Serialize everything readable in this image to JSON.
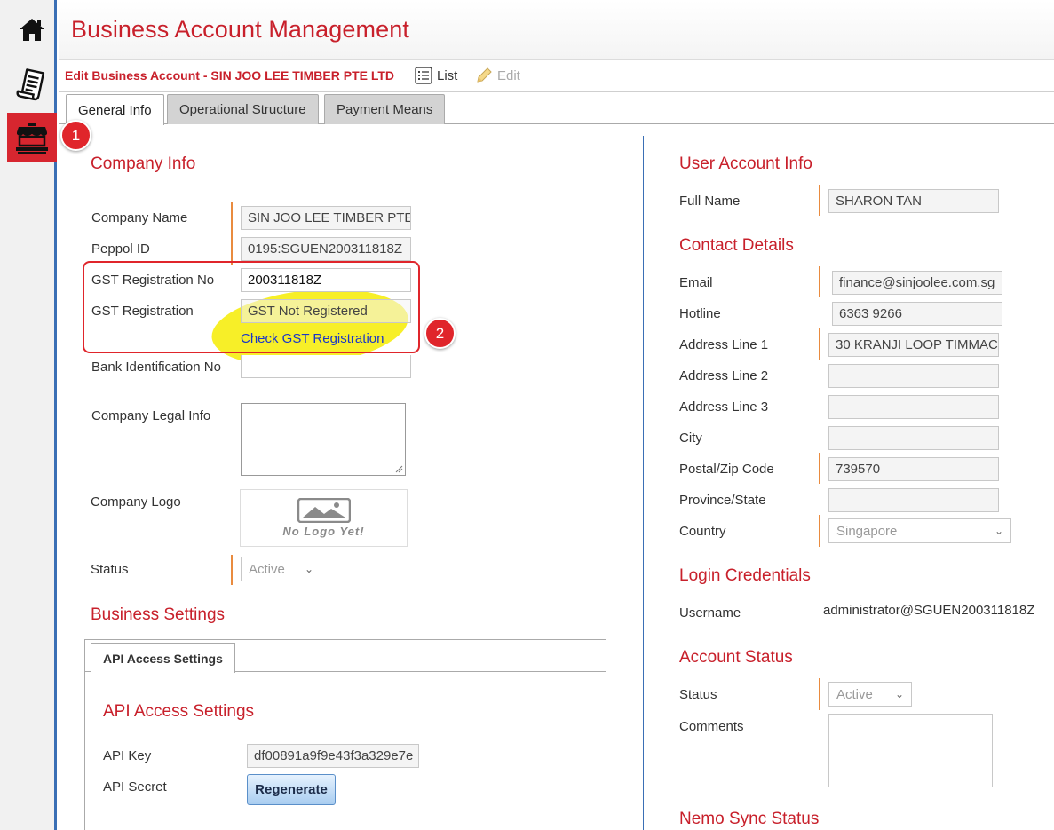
{
  "header": {
    "title": "Business Account Management"
  },
  "subbar": {
    "edit_title": "Edit Business Account - SIN JOO LEE TIMBER PTE LTD",
    "list_label": "List",
    "edit_label": "Edit"
  },
  "tabs": [
    {
      "label": "General Info"
    },
    {
      "label": "Operational Structure"
    },
    {
      "label": "Payment Means"
    }
  ],
  "badges": [
    "1",
    "2"
  ],
  "company": {
    "section": "Company Info",
    "name_label": "Company Name",
    "name_value": "SIN JOO LEE TIMBER PTE LTD",
    "peppol_label": "Peppol ID",
    "peppol_value": "0195:SGUEN200311818Z",
    "gstno_label": "GST Registration No",
    "gstno_value": "200311818Z",
    "gstreg_label": "GST Registration",
    "gstreg_value": "GST Not Registered",
    "check_link": "Check GST Registration",
    "bank_label": "Bank Identification No",
    "legal_label": "Company Legal Info",
    "logo_label": "Company Logo",
    "logo_text": "No Logo Yet!",
    "status_label": "Status",
    "status_value": "Active"
  },
  "business": {
    "section": "Business Settings",
    "tab": "API Access Settings",
    "subsection": "API Access Settings",
    "key_label": "API Key",
    "key_value": "df00891a9f9e43f3a329e7e",
    "secret_label": "API Secret",
    "regen_label": "Regenerate"
  },
  "user": {
    "section": "User Account Info",
    "fullname_label": "Full Name",
    "fullname_value": "SHARON TAN"
  },
  "contact": {
    "section": "Contact Details",
    "email_label": "Email",
    "email_value": "finance@sinjoolee.com.sg",
    "hotline_label": "Hotline",
    "hotline_value": "6363 9266",
    "addr1_label": "Address Line 1",
    "addr1_value": "30 KRANJI LOOP TIMMAC",
    "addr2_label": "Address Line 2",
    "addr2_value": "",
    "addr3_label": "Address Line 3",
    "addr3_value": "",
    "city_label": "City",
    "city_value": "",
    "postal_label": "Postal/Zip Code",
    "postal_value": "739570",
    "province_label": "Province/State",
    "province_value": "",
    "country_label": "Country",
    "country_value": "Singapore"
  },
  "login": {
    "section": "Login Credentials",
    "username_label": "Username",
    "username_value": "administrator@SGUEN200311818Z"
  },
  "account": {
    "section": "Account Status",
    "status_label": "Status",
    "status_value": "Active",
    "comments_label": "Comments"
  },
  "nemo": {
    "section": "Nemo Sync Status"
  },
  "colors": {
    "brand_red": "#c8202b",
    "sidebar_active": "#d7262f",
    "accent_blue": "#3a6fb5",
    "required": "#e98b3f",
    "highlight": "#f7ee1c"
  }
}
